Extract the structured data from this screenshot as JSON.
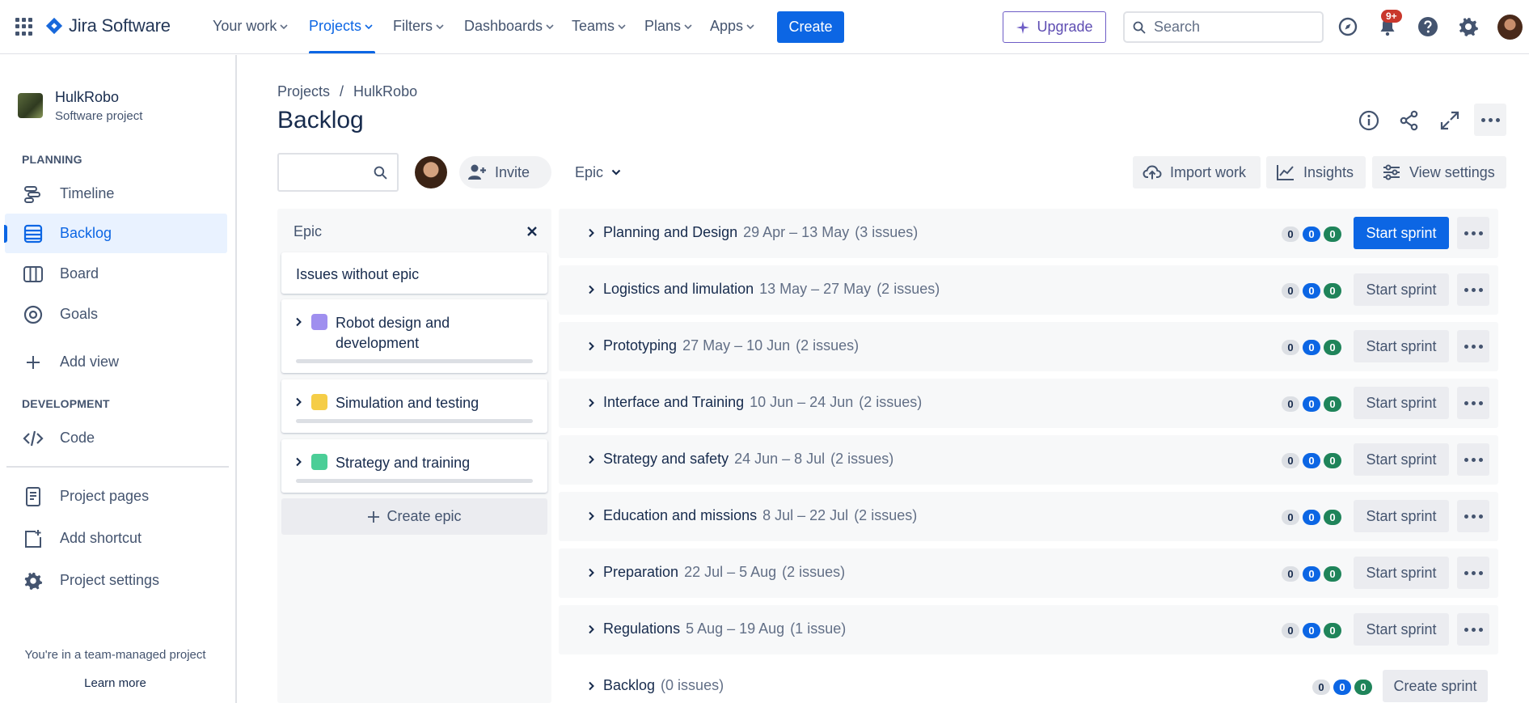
{
  "app": {
    "name": "Jira Software"
  },
  "topnav": {
    "items": [
      {
        "label": "Your work"
      },
      {
        "label": "Projects"
      },
      {
        "label": "Filters"
      },
      {
        "label": "Dashboards"
      },
      {
        "label": "Teams"
      },
      {
        "label": "Plans"
      },
      {
        "label": "Apps"
      }
    ],
    "create_label": "Create",
    "upgrade_label": "Upgrade",
    "search_placeholder": "Search",
    "notifications_badge": "9+"
  },
  "sidebar": {
    "project_name": "HulkRobo",
    "project_type": "Software project",
    "planning_heading": "PLANNING",
    "planning_items": [
      {
        "label": "Timeline",
        "icon": "timeline-icon"
      },
      {
        "label": "Backlog",
        "icon": "backlog-icon"
      },
      {
        "label": "Board",
        "icon": "board-icon"
      },
      {
        "label": "Goals",
        "icon": "goals-icon"
      }
    ],
    "add_view_label": "Add view",
    "development_heading": "DEVELOPMENT",
    "code_label": "Code",
    "bottom_items": [
      {
        "label": "Project pages"
      },
      {
        "label": "Add shortcut"
      },
      {
        "label": "Project settings"
      }
    ],
    "footer_text": "You're in a team-managed project",
    "learn_more_label": "Learn more"
  },
  "breadcrumb": {
    "projects": "Projects",
    "separator": "/",
    "project": "HulkRobo"
  },
  "page_title": "Backlog",
  "toolbar": {
    "invite_label": "Invite",
    "epic_filter_label": "Epic",
    "import_label": "Import work",
    "insights_label": "Insights",
    "view_settings_label": "View settings"
  },
  "epic_panel": {
    "title": "Epic",
    "issues_without_epic": "Issues without epic",
    "epics": [
      {
        "name": "Robot design and development",
        "color": "#9f8fef"
      },
      {
        "name": "Simulation and testing",
        "color": "#f5cd47"
      },
      {
        "name": "Strategy and training",
        "color": "#4bce97"
      }
    ],
    "create_epic_label": "Create epic"
  },
  "sprints": [
    {
      "name": "Planning and Design",
      "dates": "29 Apr – 13 May",
      "issues": "(3 issues)",
      "todo": "0",
      "inprogress": "0",
      "done": "0",
      "button": "Start sprint",
      "primary": true
    },
    {
      "name": "Logistics and limulation",
      "dates": "13 May – 27 May",
      "issues": "(2 issues)",
      "todo": "0",
      "inprogress": "0",
      "done": "0",
      "button": "Start sprint",
      "primary": false
    },
    {
      "name": "Prototyping",
      "dates": "27 May – 10 Jun",
      "issues": "(2 issues)",
      "todo": "0",
      "inprogress": "0",
      "done": "0",
      "button": "Start sprint",
      "primary": false
    },
    {
      "name": "Interface and Training",
      "dates": "10 Jun – 24 Jun",
      "issues": "(2 issues)",
      "todo": "0",
      "inprogress": "0",
      "done": "0",
      "button": "Start sprint",
      "primary": false
    },
    {
      "name": "Strategy and safety",
      "dates": "24 Jun – 8 Jul",
      "issues": "(2 issues)",
      "todo": "0",
      "inprogress": "0",
      "done": "0",
      "button": "Start sprint",
      "primary": false
    },
    {
      "name": "Education and missions",
      "dates": "8 Jul – 22 Jul",
      "issues": "(2 issues)",
      "todo": "0",
      "inprogress": "0",
      "done": "0",
      "button": "Start sprint",
      "primary": false
    },
    {
      "name": "Preparation",
      "dates": "22 Jul – 5 Aug",
      "issues": "(2 issues)",
      "todo": "0",
      "inprogress": "0",
      "done": "0",
      "button": "Start sprint",
      "primary": false
    },
    {
      "name": "Regulations",
      "dates": "5 Aug – 19 Aug",
      "issues": "(1 issue)",
      "todo": "0",
      "inprogress": "0",
      "done": "0",
      "button": "Start sprint",
      "primary": false
    }
  ],
  "backlog": {
    "name": "Backlog",
    "issues": "(0 issues)",
    "todo": "0",
    "inprogress": "0",
    "done": "0",
    "button": "Create sprint"
  }
}
